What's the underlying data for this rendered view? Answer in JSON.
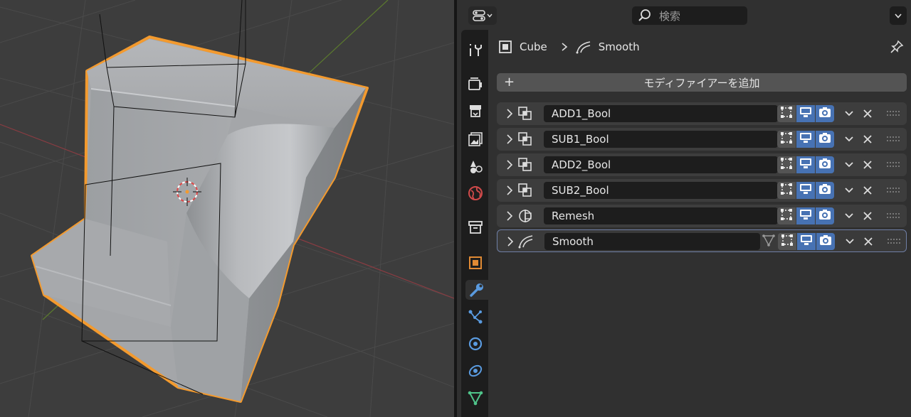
{
  "header": {
    "search_placeholder": "検索",
    "icons": [
      "editor-type-icon",
      "search-icon",
      "chevron-down-icon"
    ]
  },
  "tabs": [
    {
      "name": "tool",
      "icon": "tool-icon"
    },
    {
      "name": "render",
      "icon": "render-icon"
    },
    {
      "name": "output",
      "icon": "output-icon"
    },
    {
      "name": "view-layer",
      "icon": "view-layer-icon"
    },
    {
      "name": "scene",
      "icon": "scene-icon"
    },
    {
      "name": "world",
      "icon": "world-icon"
    },
    {
      "name": "collection",
      "icon": "collection-icon"
    },
    {
      "name": "object",
      "icon": "object-icon"
    },
    {
      "name": "modifiers",
      "icon": "wrench-icon",
      "active": true
    },
    {
      "name": "particles",
      "icon": "particles-icon"
    },
    {
      "name": "physics",
      "icon": "physics-icon"
    },
    {
      "name": "constraints",
      "icon": "constraint-icon"
    },
    {
      "name": "data",
      "icon": "mesh-data-icon"
    }
  ],
  "breadcrumb": {
    "object": "Cube",
    "modifier": "Smooth"
  },
  "add_modifier_label": "モディファイアーを追加",
  "modifiers": [
    {
      "name": "ADD1_Bool",
      "type": "boolean",
      "icon": "boolean-icon",
      "editmode": true,
      "viewport": true,
      "render": true
    },
    {
      "name": "SUB1_Bool",
      "type": "boolean",
      "icon": "boolean-icon",
      "editmode": true,
      "viewport": true,
      "render": true
    },
    {
      "name": "ADD2_Bool",
      "type": "boolean",
      "icon": "boolean-icon",
      "editmode": true,
      "viewport": true,
      "render": true
    },
    {
      "name": "SUB2_Bool",
      "type": "boolean",
      "icon": "boolean-icon",
      "editmode": true,
      "viewport": true,
      "render": true
    },
    {
      "name": "Remesh",
      "type": "remesh",
      "icon": "remesh-icon",
      "editmode": true,
      "viewport": true,
      "render": true
    },
    {
      "name": "Smooth",
      "type": "smooth",
      "icon": "smooth-icon",
      "oncage": true,
      "editmode": true,
      "viewport": true,
      "render": true,
      "selected": true
    }
  ],
  "colors": {
    "accent": "#4772b3",
    "selection_outline": "#f39a2e",
    "panel_bg": "#303030",
    "row_bg": "#3d3d3d",
    "field_bg": "#1d1d1d"
  }
}
